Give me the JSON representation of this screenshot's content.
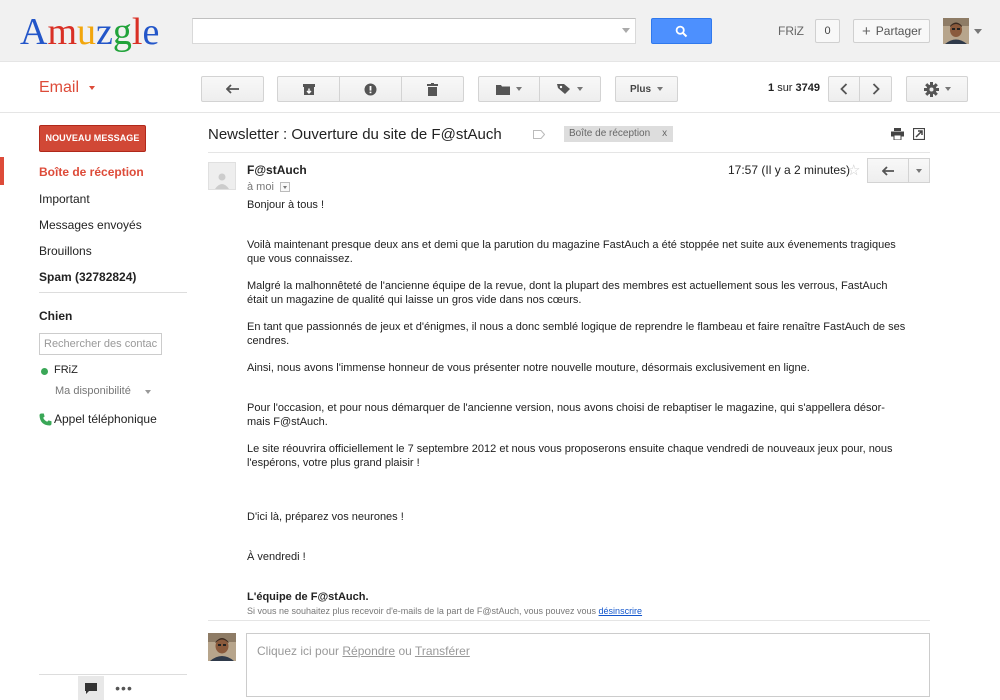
{
  "header": {
    "logo": "Amuzgle",
    "logo_letter_colors": [
      "#2356c9",
      "#d93025",
      "#f2a60c",
      "#2356c9",
      "#21a33a",
      "#d93025",
      "#2356c9"
    ],
    "search": {
      "value": "",
      "placeholder": ""
    },
    "user_name": "FRiZ",
    "notification_count": "0",
    "share_label": "Partager"
  },
  "toolbar": {
    "email_menu": "Email",
    "more_label": "Plus",
    "page": {
      "current": "1",
      "of": "sur",
      "total": "3749"
    }
  },
  "sidebar": {
    "compose_label": "NOUVEAU MESSAGE",
    "items": [
      {
        "label": "Boîte de réception",
        "active": true
      },
      {
        "label": "Important"
      },
      {
        "label": "Messages envoyés"
      },
      {
        "label": "Brouillons"
      },
      {
        "label": "Spam (32782824)"
      }
    ],
    "chat": {
      "title": "Chien",
      "search_placeholder": "Rechercher des contacts",
      "user": "FRiZ",
      "availability": "Ma disponibilité",
      "phone_call": "Appel téléphonique"
    }
  },
  "message": {
    "subject": "Newsletter : Ouverture du site de F@stAuch",
    "label": "Boîte de réception",
    "label_remove": "x",
    "sender": "F@stAuch",
    "recipient": "à moi",
    "time": "17:57 (Il y a 2 minutes)",
    "body": [
      "Bonjour à tous !",
      "Voilà maintenant presque deux ans et demi que la parution du magazine FastAuch a été stoppée net suite aux évenements tragiques que vous connaissez.",
      "Malgré la malhonnêteté de l'ancienne équipe de la revue, dont la plupart des membres est actuellement sous les verrous, FastAuch était un magazine de qualité qui laisse un gros vide dans nos cœurs.",
      "En tant que passionnés de jeux et d'énigmes, il nous a donc semblé logique de reprendre le flambeau et faire renaître FastAuch de ses cendres.",
      "Ainsi, nous avons l'immense honneur de vous présenter notre nouvelle mouture, désormais exclusivement en ligne.",
      "Pour l'occasion, et pour nous démarquer de l'ancienne version, nous avons choisi de rebaptiser le magazine, qui s'appellera désor-mais F@stAuch.",
      "Le site réouvrira officiellement le 7 septembre 2012 et nous vous proposerons ensuite chaque vendredi de nouveaux jeux pour, nous l'espérons, votre plus grand plaisir !",
      "D'ici là, préparez vos neurones !",
      "À vendredi !"
    ],
    "signature": "L'équipe de F@stAuch.",
    "unsubscribe_text": "Si vous ne souhaitez plus recevoir d'e-mails de la part de F@stAuch, vous pouvez vous",
    "unsubscribe_link": "désinscrire"
  },
  "reply": {
    "prefix": "Cliquez ici pour",
    "reply_link": "Répondre",
    "or": "ou",
    "forward_link": "Transférer"
  }
}
